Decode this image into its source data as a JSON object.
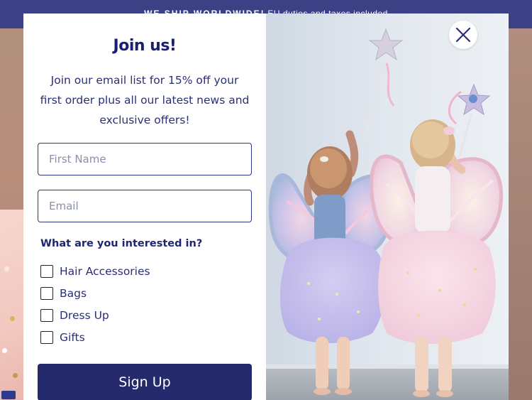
{
  "announcement": {
    "bold_text": "WE SHIP WORLDWIDE!",
    "text": "EU duties and taxes included"
  },
  "modal": {
    "title": "Join us!",
    "subtitle": "Join our email list for 15% off your first order plus all our latest news and exclusive offers!",
    "first_name_placeholder": "First Name",
    "first_name_value": "",
    "email_placeholder": "Email",
    "email_value": "",
    "interest_heading": "What are you interested in?",
    "interests": [
      {
        "label": "Hair Accessories",
        "checked": false
      },
      {
        "label": "Bags",
        "checked": false
      },
      {
        "label": "Dress Up",
        "checked": false
      },
      {
        "label": "Gifts",
        "checked": false
      }
    ],
    "submit_label": "Sign Up",
    "close_icon": "close-icon",
    "photo_icon": "photo-two-girls-fairy-wings"
  },
  "colors": {
    "brand_navy": "#242a6b",
    "heading_navy": "#1a1f6e",
    "announce_bar": "#3b4184",
    "backdrop": "#b89584"
  }
}
